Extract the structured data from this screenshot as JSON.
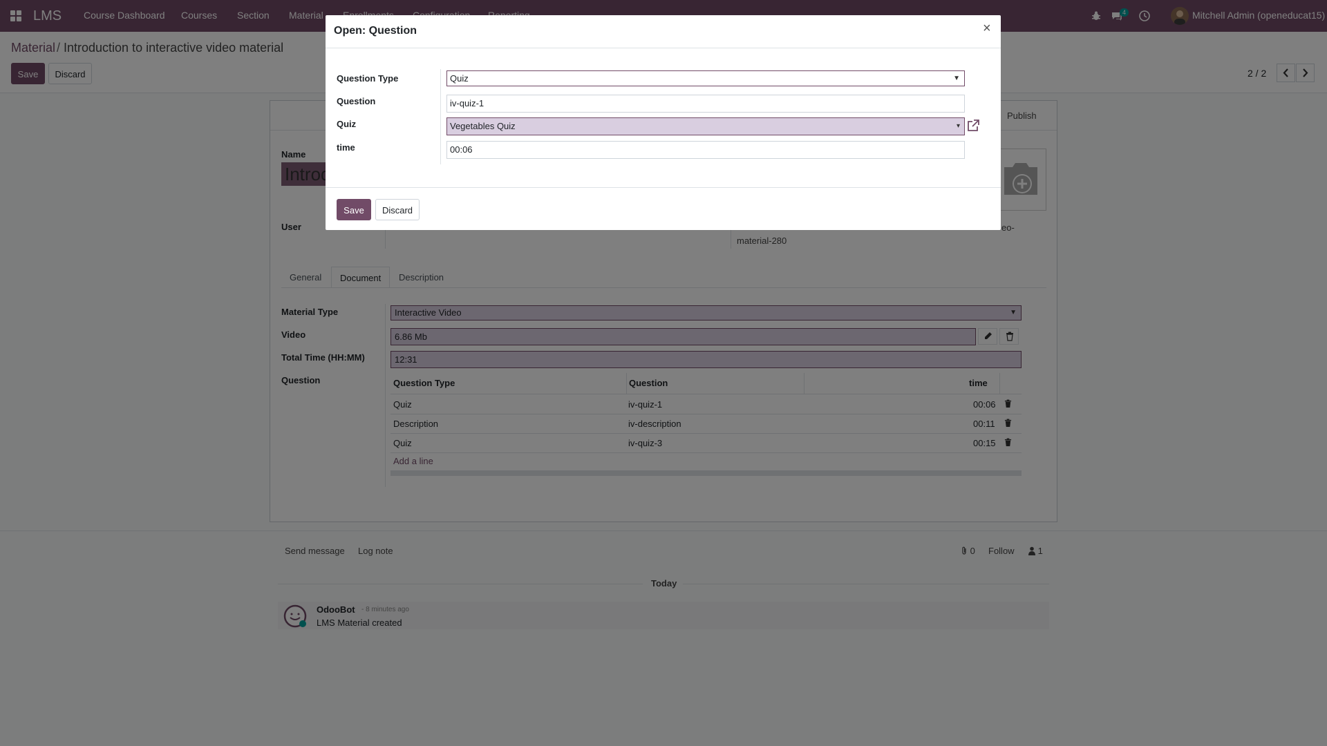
{
  "navbar": {
    "brand": "LMS",
    "menu": [
      "Course Dashboard",
      "Courses",
      "Section",
      "Material",
      "Enrollments",
      "Configuration",
      "Reporting"
    ],
    "messages_badge": "4",
    "user": "Mitchell Admin (openeducat15)"
  },
  "breadcrumb": {
    "parent": "Material",
    "separator": "/",
    "current": "Introduction to interactive video material"
  },
  "control": {
    "save": "Save",
    "discard": "Discard",
    "pager": "2 / 2"
  },
  "form": {
    "publish": "Publish",
    "name_label": "Name",
    "name_value": "Introduction to interactive video material",
    "user_label": "User",
    "right_info_1": "eo-",
    "right_info_2": "material-280",
    "tabs": [
      "General",
      "Document",
      "Description"
    ],
    "material_type_label": "Material Type",
    "material_type_value": "Interactive Video",
    "video_label": "Video",
    "video_value": "6.86 Mb",
    "total_time_label": "Total Time (HH:MM)",
    "total_time_value": "12:31",
    "question_label": "Question",
    "table": {
      "headers": [
        "Question Type",
        "Question",
        "time"
      ],
      "rows": [
        {
          "type": "Quiz",
          "question": "iv-quiz-1",
          "time": "00:06"
        },
        {
          "type": "Description",
          "question": "iv-description",
          "time": "00:11"
        },
        {
          "type": "Quiz",
          "question": "iv-quiz-3",
          "time": "00:15"
        }
      ],
      "add_line": "Add a line"
    }
  },
  "chatter": {
    "send_message": "Send message",
    "log_note": "Log note",
    "attachments": "0",
    "follow": "Follow",
    "followers": "1",
    "today": "Today",
    "author": "OdooBot",
    "time": "- 8 minutes ago",
    "body": "LMS Material created"
  },
  "modal": {
    "title": "Open: Question",
    "close": "×",
    "question_type_label": "Question Type",
    "question_type_value": "Quiz",
    "question_label": "Question",
    "question_value": "iv-quiz-1",
    "quiz_label": "Quiz",
    "quiz_value": "Vegetables Quiz",
    "time_label": "time",
    "time_value": "00:06",
    "save": "Save",
    "discard": "Discard"
  },
  "colors": {
    "brand": "#714b67",
    "field_bg": "#d9cee0",
    "badge": "#00a09d"
  },
  "icons": [
    "apps-icon",
    "bug-icon",
    "chat-icon",
    "clock-icon",
    "chevron-left-icon",
    "chevron-right-icon",
    "camera-plus-icon",
    "pencil-icon",
    "trash-icon",
    "external-link-icon",
    "paperclip-icon",
    "user-icon",
    "odoobot-icon"
  ]
}
